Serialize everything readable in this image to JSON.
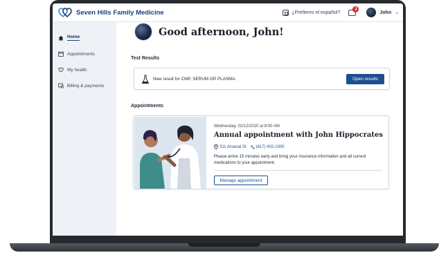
{
  "header": {
    "brand_name": "Seven Hills Family Medicine",
    "language_link": "¿Prefieres el español?",
    "messages_badge": "3",
    "user_name": "John"
  },
  "sidebar": {
    "items": [
      {
        "label": "Home",
        "icon": "home-icon",
        "active": true
      },
      {
        "label": "Appointments",
        "icon": "calendar-icon",
        "active": false
      },
      {
        "label": "My health",
        "icon": "heart-icon",
        "active": false
      },
      {
        "label": "Billing & payments",
        "icon": "billing-icon",
        "active": false
      }
    ]
  },
  "main": {
    "greeting": "Good afternoon, John!",
    "test_results": {
      "title": "Test Results",
      "message": "New result for CMP, SERUM OR PLASMA.",
      "button": "Open results"
    },
    "appointments": {
      "title": "Appointments",
      "date": "Wednesday, 02/12/2020 at 8:00 AM",
      "heading": "Annual appointment with John Hippocrates",
      "address": "311 Arsenal St",
      "phone": "(617) 402-1000",
      "note": "Please arrive 15 minutes early and bring your insurance information and all current medications to your appointment.",
      "button": "Manage appointment"
    }
  },
  "colors": {
    "brand": "#1c3f80",
    "primary_button": "#1c4f8f",
    "sidebar_bg": "#eef2f7",
    "badge": "#d0282e"
  }
}
